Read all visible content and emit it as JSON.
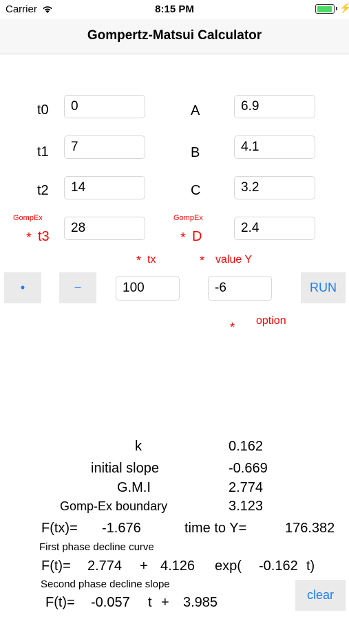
{
  "status_bar": {
    "carrier": "Carrier",
    "time": "8:15 PM"
  },
  "nav": {
    "title": "Gompertz-Matsui Calculator"
  },
  "inputs": {
    "t0": {
      "label": "t0",
      "value": "0"
    },
    "t1": {
      "label": "t1",
      "value": "7"
    },
    "t2": {
      "label": "t2",
      "value": "14"
    },
    "t3": {
      "label": "t3",
      "value": "28",
      "tag": "GompEx",
      "star": "*"
    },
    "A": {
      "label": "A",
      "value": "6.9"
    },
    "B": {
      "label": "B",
      "value": "4.1"
    },
    "C": {
      "label": "C",
      "value": "3.2"
    },
    "D": {
      "label": "D",
      "value": "2.4",
      "tag": "GompEx",
      "star": "*"
    }
  },
  "controls": {
    "tx_label": "tx",
    "valueY_label": "value Y",
    "star": "*",
    "dot_button": "•",
    "minus_button": "−",
    "tx_value": "100",
    "y_value": "-6",
    "run_button": "RUN",
    "option_label": "option",
    "option_star": "*"
  },
  "results": {
    "k_label": "k",
    "k_value": "0.162",
    "initial_slope_label": "initial slope",
    "initial_slope_value": "-0.669",
    "gmi_label": "G.M.I",
    "gmi_value": "2.774",
    "boundary_label": "Gomp-Ex boundary",
    "boundary_value": "3.123",
    "ftx_label": "F(tx)=",
    "ftx_value": "-1.676",
    "time_to_y_label": "time to Y=",
    "time_to_y_value": "176.382",
    "first_phase_title": "First phase decline curve",
    "first_phase": {
      "f": "F(t)=",
      "a": "2.774",
      "plus": "+",
      "b": "4.126",
      "exp": "exp(",
      "c": "-0.162",
      "t": "t)"
    },
    "second_phase_title": "Second phase decline slope",
    "second_phase": {
      "f": "F(t)=",
      "a": "-0.057",
      "t": "t",
      "plus": "+",
      "b": "3.985"
    },
    "clear_button": "clear"
  },
  "colors": {
    "accent": "#1b7cf7",
    "required": "#ff0000",
    "battery": "#4cd964"
  }
}
